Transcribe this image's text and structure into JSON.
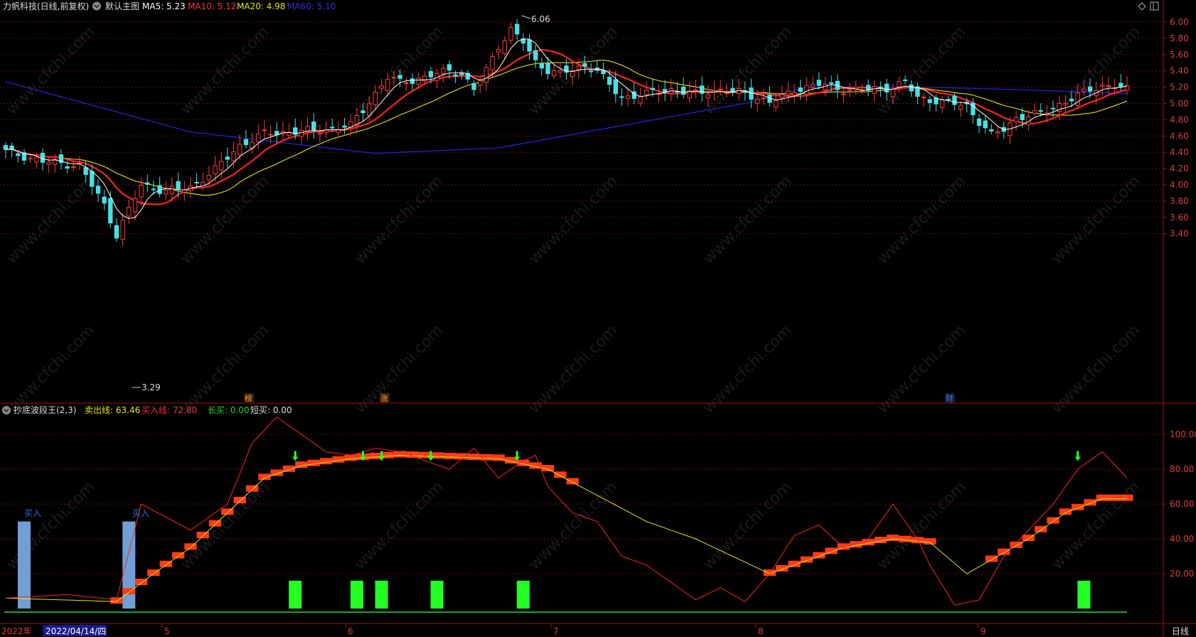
{
  "main_header": {
    "stock_title": "力帆科技(日线,前复权)",
    "view_name": "默认主图",
    "ma5_label": "MA5: 5.23",
    "ma10_label": "MA10: 5.12",
    "ma20_label": "MA20: 4.98",
    "ma60_label": "MA60: 5.10"
  },
  "price_axis": {
    "ticks": [
      "6.00",
      "5.80",
      "5.60",
      "5.40",
      "5.20",
      "5.00",
      "4.80",
      "4.60",
      "4.40",
      "4.20",
      "4.00",
      "3.80",
      "3.60",
      "3.40"
    ]
  },
  "annotations": {
    "high": "6.06",
    "low": "3.29"
  },
  "event_markers": [
    {
      "text": "榜",
      "color": "#e8a33a"
    },
    {
      "text": "涨",
      "color": "#e8a33a"
    },
    {
      "text": "财",
      "color": "#4a7fd6"
    }
  ],
  "indicator_header": {
    "name": "抄底波段王(2,3)",
    "sell_line": "卖出线: 63.46",
    "buy_line": "买入线: 72.80",
    "long_buy": "长买: 0.00",
    "short_buy": "短买: 0.00"
  },
  "indicator_axis": {
    "ticks": [
      "100.00",
      "80.00",
      "60.00",
      "40.00",
      "20.00"
    ]
  },
  "buy_labels": [
    "买入",
    "买入"
  ],
  "date_axis": {
    "year": "2022年",
    "current_date": "2022/04/14/四",
    "months": [
      "5",
      "6",
      "7",
      "8",
      "9"
    ],
    "period": "日线"
  },
  "watermark": "www.cfchi.com",
  "colors": {
    "up": "#ff3b3b",
    "down": "#44e3e3",
    "ma5": "#ffffff",
    "ma10": "#ff2020",
    "ma20": "#e6e600",
    "ma60": "#2020d0",
    "grid": "#7a1010",
    "axis_text": "#e03a3a"
  }
}
